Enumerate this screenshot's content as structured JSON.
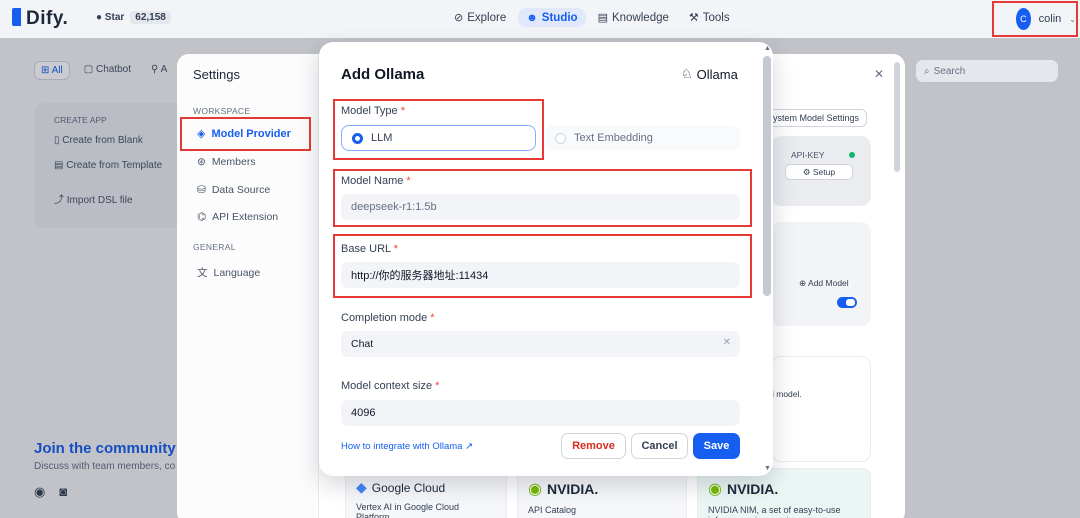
{
  "header": {
    "logo": "Dify.",
    "star_label": "Star",
    "star_count": "62,158",
    "nav": [
      {
        "label": "Explore",
        "icon": "compass-icon"
      },
      {
        "label": "Studio",
        "icon": "robot-icon"
      },
      {
        "label": "Knowledge",
        "icon": "book-icon"
      },
      {
        "label": "Tools",
        "icon": "tools-icon"
      }
    ],
    "user_initial": "C",
    "user_name": "colin"
  },
  "background_page": {
    "tabs": [
      "All",
      "Chatbot",
      "A"
    ],
    "create_header": "CREATE APP",
    "create_items": [
      "Create from Blank",
      "Create from Template",
      "Import DSL file"
    ],
    "community_title": "Join the community",
    "community_sub": "Discuss with team members, co"
  },
  "settings": {
    "title": "Settings",
    "workspace_header": "WORKSPACE",
    "workspace_items": [
      "Model Provider",
      "Members",
      "Data Source",
      "API Extension"
    ],
    "general_header": "GENERAL",
    "general_items": [
      "Language"
    ],
    "search_placeholder": "Search",
    "system_model_btn": "ystem Model Settings",
    "api_key_label": "API-KEY",
    "setup_label": "Setup",
    "add_model_label": "Add Model",
    "model_text": "i model.",
    "bottom_cards": [
      {
        "brand": "Google Cloud",
        "desc": "Vertex AI in Google Cloud Platform."
      },
      {
        "brand": "NVIDIA.",
        "desc": "API Catalog"
      },
      {
        "brand": "NVIDIA.",
        "desc": "NVIDIA NIM, a set of easy-to-use inference microservices"
      }
    ]
  },
  "modal": {
    "title": "Add Ollama",
    "brand": "Ollama",
    "model_type_label": "Model Type",
    "model_type_options": [
      {
        "label": "LLM",
        "selected": true
      },
      {
        "label": "Text Embedding",
        "selected": false
      }
    ],
    "model_name_label": "Model Name",
    "model_name_value": "deepseek-r1:1.5b",
    "base_url_label": "Base URL",
    "base_url_value": "http://你的服务器地址:11434",
    "completion_mode_label": "Completion mode",
    "completion_mode_value": "Chat",
    "context_size_label": "Model context size",
    "context_size_value": "4096",
    "help_link": "How to integrate with Ollama",
    "remove_label": "Remove",
    "cancel_label": "Cancel",
    "save_label": "Save"
  },
  "colors": {
    "primary": "#155eef",
    "danger": "#d92d20",
    "highlight_box": "#e53935"
  }
}
